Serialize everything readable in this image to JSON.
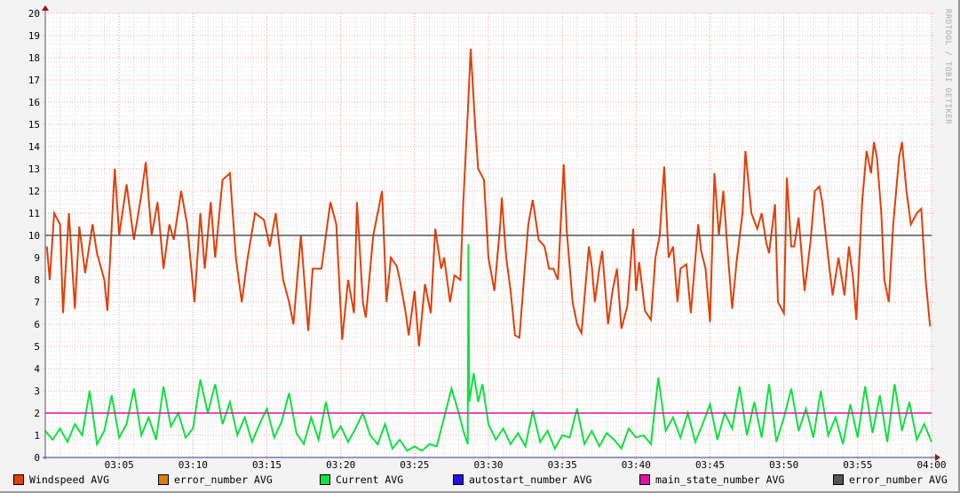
{
  "watermark": "RRDTOOL / TOBI OETIKER",
  "chart_data": {
    "type": "line",
    "title": "",
    "xlabel": "",
    "ylabel": "",
    "ylim": [
      0,
      20
    ],
    "xlim_minutes": [
      0,
      60
    ],
    "y_ticks": [
      "0",
      "1",
      "2",
      "3",
      "4",
      "5",
      "6",
      "7",
      "8",
      "9",
      "10",
      "11",
      "12",
      "13",
      "14",
      "15",
      "16",
      "17",
      "18",
      "19",
      "20"
    ],
    "x_ticks": [
      {
        "t": 5,
        "label": "03:05"
      },
      {
        "t": 10,
        "label": "03:10"
      },
      {
        "t": 15,
        "label": "03:15"
      },
      {
        "t": 20,
        "label": "03:20"
      },
      {
        "t": 25,
        "label": "03:25"
      },
      {
        "t": 30,
        "label": "03:30"
      },
      {
        "t": 35,
        "label": "03:35"
      },
      {
        "t": 40,
        "label": "03:40"
      },
      {
        "t": 45,
        "label": "03:45"
      },
      {
        "t": 50,
        "label": "03:50"
      },
      {
        "t": 55,
        "label": "03:55"
      },
      {
        "t": 60,
        "label": "04:00"
      }
    ],
    "grid": true,
    "legend_position": "bottom",
    "legend": [
      {
        "label": "Windspeed AVG",
        "color": "#e0400a"
      },
      {
        "label": "error_number AVG",
        "color": "#e07a0a"
      },
      {
        "label": "Current AVG",
        "color": "#10e040"
      },
      {
        "label": "autostart_number AVG",
        "color": "#2a10e0"
      },
      {
        "label": "main_state_number AVG",
        "color": "#e010a0"
      },
      {
        "label": "error_number AVG",
        "color": "#555555"
      }
    ],
    "series": [
      {
        "name": "Windspeed AVG",
        "color": "#e0400a",
        "points": [
          [
            0.1,
            9.5
          ],
          [
            0.3,
            8
          ],
          [
            0.6,
            11
          ],
          [
            1.0,
            10.5
          ],
          [
            1.2,
            6.5
          ],
          [
            1.6,
            11
          ],
          [
            2.0,
            6.7
          ],
          [
            2.3,
            10.4
          ],
          [
            2.7,
            8.3
          ],
          [
            3.2,
            10.5
          ],
          [
            3.5,
            9.2
          ],
          [
            4.0,
            8
          ],
          [
            4.2,
            6.6
          ],
          [
            4.7,
            13
          ],
          [
            5.0,
            10
          ],
          [
            5.5,
            12.3
          ],
          [
            6.0,
            9.8
          ],
          [
            6.5,
            11.8
          ],
          [
            6.8,
            13.3
          ],
          [
            7.2,
            10
          ],
          [
            7.6,
            11.5
          ],
          [
            8.0,
            8.5
          ],
          [
            8.4,
            10.5
          ],
          [
            8.7,
            9.8
          ],
          [
            9.2,
            12
          ],
          [
            9.6,
            10.5
          ],
          [
            10.1,
            7
          ],
          [
            10.5,
            11
          ],
          [
            10.8,
            8.5
          ],
          [
            11.2,
            11.5
          ],
          [
            11.5,
            9
          ],
          [
            12.0,
            12.5
          ],
          [
            12.5,
            12.8
          ],
          [
            12.9,
            9
          ],
          [
            13.3,
            7
          ],
          [
            13.7,
            9
          ],
          [
            14.2,
            11
          ],
          [
            14.8,
            10.7
          ],
          [
            15.2,
            9.5
          ],
          [
            15.6,
            11
          ],
          [
            16.1,
            8
          ],
          [
            16.5,
            7
          ],
          [
            16.8,
            6
          ],
          [
            17.3,
            10
          ],
          [
            17.8,
            5.7
          ],
          [
            18.1,
            8.5
          ],
          [
            18.7,
            8.5
          ],
          [
            19.3,
            11.5
          ],
          [
            19.7,
            10.5
          ],
          [
            20.1,
            5.3
          ],
          [
            20.5,
            8
          ],
          [
            20.9,
            6.5
          ],
          [
            21.1,
            11.5
          ],
          [
            21.5,
            7
          ],
          [
            21.7,
            6.3
          ],
          [
            22.2,
            10
          ],
          [
            22.5,
            11
          ],
          [
            22.8,
            12
          ],
          [
            23.1,
            7
          ],
          [
            23.4,
            9
          ],
          [
            23.8,
            8.6
          ],
          [
            24.0,
            8
          ],
          [
            24.4,
            6.5
          ],
          [
            24.6,
            5.5
          ],
          [
            25.0,
            7.5
          ],
          [
            25.3,
            5
          ],
          [
            25.7,
            7.8
          ],
          [
            26.1,
            6.5
          ],
          [
            26.4,
            10.3
          ],
          [
            26.8,
            8.5
          ],
          [
            27.0,
            9
          ],
          [
            27.4,
            7
          ],
          [
            27.7,
            8.2
          ],
          [
            28.1,
            8
          ],
          [
            28.3,
            11.5
          ],
          [
            28.6,
            15.5
          ],
          [
            28.8,
            18.4
          ],
          [
            29.1,
            15
          ],
          [
            29.3,
            13
          ],
          [
            29.7,
            12.5
          ],
          [
            30.0,
            9
          ],
          [
            30.4,
            7.5
          ],
          [
            30.8,
            10.5
          ],
          [
            30.9,
            11.7
          ],
          [
            31.2,
            9
          ],
          [
            31.5,
            7.5
          ],
          [
            31.8,
            5.5
          ],
          [
            32.1,
            5.4
          ],
          [
            32.4,
            8
          ],
          [
            32.7,
            10.5
          ],
          [
            33.0,
            11.6
          ],
          [
            33.4,
            9.8
          ],
          [
            33.8,
            9.5
          ],
          [
            34.1,
            8.5
          ],
          [
            34.4,
            8.5
          ],
          [
            34.7,
            8
          ],
          [
            35.1,
            13.2
          ],
          [
            35.3,
            10.2
          ],
          [
            35.7,
            7
          ],
          [
            36.0,
            6
          ],
          [
            36.3,
            5.6
          ],
          [
            36.8,
            9.5
          ],
          [
            37.0,
            8.6
          ],
          [
            37.2,
            7
          ],
          [
            37.5,
            8.5
          ],
          [
            37.7,
            9.3
          ],
          [
            38.1,
            6
          ],
          [
            38.4,
            7.5
          ],
          [
            38.7,
            8.5
          ],
          [
            39.0,
            5.8
          ],
          [
            39.4,
            6.8
          ],
          [
            39.8,
            10.3
          ],
          [
            40.0,
            7.5
          ],
          [
            40.2,
            8.8
          ],
          [
            40.6,
            6.6
          ],
          [
            41.0,
            6.2
          ],
          [
            41.3,
            9
          ],
          [
            41.6,
            10
          ],
          [
            41.9,
            13.1
          ],
          [
            42.2,
            9
          ],
          [
            42.5,
            9.5
          ],
          [
            42.8,
            7
          ],
          [
            43.0,
            8.5
          ],
          [
            43.4,
            8.7
          ],
          [
            43.7,
            6.5
          ],
          [
            44.2,
            10.5
          ],
          [
            44.4,
            9.3
          ],
          [
            44.7,
            8.5
          ],
          [
            45.0,
            6.1
          ],
          [
            45.3,
            12.8
          ],
          [
            45.6,
            10
          ],
          [
            45.9,
            12
          ],
          [
            46.2,
            9.2
          ],
          [
            46.5,
            6.7
          ],
          [
            46.8,
            8.8
          ],
          [
            47.2,
            11
          ],
          [
            47.4,
            13.8
          ],
          [
            47.8,
            11
          ],
          [
            48.2,
            10.3
          ],
          [
            48.5,
            11
          ],
          [
            48.8,
            9.7
          ],
          [
            49.0,
            9.2
          ],
          [
            49.4,
            11.4
          ],
          [
            49.6,
            7
          ],
          [
            50.0,
            6.5
          ],
          [
            50.2,
            12.6
          ],
          [
            50.5,
            9.5
          ],
          [
            50.7,
            9.5
          ],
          [
            51.0,
            10.8
          ],
          [
            51.4,
            7.5
          ],
          [
            51.8,
            9.7
          ],
          [
            52.1,
            12
          ],
          [
            52.4,
            12.2
          ],
          [
            52.6,
            11.5
          ],
          [
            53.0,
            9
          ],
          [
            53.3,
            7.3
          ],
          [
            53.7,
            9
          ],
          [
            54.1,
            7.3
          ],
          [
            54.4,
            9.5
          ],
          [
            54.7,
            8
          ],
          [
            54.9,
            6.2
          ],
          [
            55.3,
            11.5
          ],
          [
            55.6,
            13.8
          ],
          [
            55.9,
            12.8
          ],
          [
            56.1,
            14.2
          ],
          [
            56.3,
            13.5
          ],
          [
            56.6,
            11
          ],
          [
            56.8,
            8
          ],
          [
            57.1,
            7
          ],
          [
            57.4,
            10.5
          ],
          [
            57.8,
            13.5
          ],
          [
            58.0,
            14.2
          ],
          [
            58.3,
            12
          ],
          [
            58.6,
            10.5
          ],
          [
            59.0,
            11
          ],
          [
            59.3,
            11.2
          ],
          [
            59.6,
            8
          ],
          [
            59.9,
            5.9
          ]
        ]
      },
      {
        "name": "Current AVG",
        "color": "#10e040",
        "points": [
          [
            0,
            1.2
          ],
          [
            0.5,
            0.8
          ],
          [
            1,
            1.3
          ],
          [
            1.5,
            0.7
          ],
          [
            2,
            1.5
          ],
          [
            2.5,
            1.0
          ],
          [
            3,
            3.0
          ],
          [
            3.5,
            0.6
          ],
          [
            4,
            1.2
          ],
          [
            4.5,
            2.8
          ],
          [
            5,
            0.9
          ],
          [
            5.5,
            1.5
          ],
          [
            6,
            3.1
          ],
          [
            6.5,
            1.0
          ],
          [
            7,
            1.8
          ],
          [
            7.5,
            0.8
          ],
          [
            8,
            3.2
          ],
          [
            8.5,
            1.4
          ],
          [
            9,
            2.0
          ],
          [
            9.5,
            0.9
          ],
          [
            10,
            1.3
          ],
          [
            10.5,
            3.5
          ],
          [
            11,
            2.0
          ],
          [
            11.5,
            3.3
          ],
          [
            12,
            1.5
          ],
          [
            12.5,
            2.5
          ],
          [
            13,
            1.0
          ],
          [
            13.5,
            1.8
          ],
          [
            14,
            0.7
          ],
          [
            14.5,
            1.5
          ],
          [
            15,
            2.2
          ],
          [
            15.5,
            0.9
          ],
          [
            16,
            1.6
          ],
          [
            16.5,
            2.9
          ],
          [
            17,
            1.1
          ],
          [
            17.5,
            0.6
          ],
          [
            18,
            1.8
          ],
          [
            18.5,
            0.8
          ],
          [
            19,
            2.5
          ],
          [
            19.5,
            0.9
          ],
          [
            20,
            1.4
          ],
          [
            20.5,
            0.7
          ],
          [
            21,
            1.3
          ],
          [
            21.5,
            2.0
          ],
          [
            22,
            1.0
          ],
          [
            22.5,
            0.6
          ],
          [
            23,
            1.5
          ],
          [
            23.5,
            0.4
          ],
          [
            24,
            0.8
          ],
          [
            24.5,
            0.3
          ],
          [
            25,
            0.5
          ],
          [
            25.5,
            0.3
          ],
          [
            26,
            0.6
          ],
          [
            26.5,
            0.5
          ],
          [
            27,
            1.8
          ],
          [
            27.5,
            3.1
          ],
          [
            28,
            2.0
          ],
          [
            28.3,
            1.2
          ],
          [
            28.6,
            0.6
          ],
          [
            28.65,
            9.6
          ],
          [
            28.7,
            2.5
          ],
          [
            29,
            3.8
          ],
          [
            29.3,
            2.5
          ],
          [
            29.6,
            3.3
          ],
          [
            30,
            1.5
          ],
          [
            30.5,
            0.8
          ],
          [
            31,
            1.3
          ],
          [
            31.5,
            0.6
          ],
          [
            32,
            1.1
          ],
          [
            32.5,
            0.5
          ],
          [
            33,
            2.1
          ],
          [
            33.5,
            0.7
          ],
          [
            34,
            1.2
          ],
          [
            34.5,
            0.4
          ],
          [
            35,
            1.0
          ],
          [
            35.5,
            0.9
          ],
          [
            36,
            2.2
          ],
          [
            36.5,
            0.6
          ],
          [
            37,
            1.2
          ],
          [
            37.5,
            0.5
          ],
          [
            38,
            1.1
          ],
          [
            38.5,
            0.8
          ],
          [
            39,
            0.4
          ],
          [
            39.5,
            1.3
          ],
          [
            40,
            0.9
          ],
          [
            40.5,
            1.0
          ],
          [
            41,
            0.6
          ],
          [
            41.5,
            3.6
          ],
          [
            42,
            1.2
          ],
          [
            42.5,
            1.8
          ],
          [
            43,
            0.9
          ],
          [
            43.5,
            2.0
          ],
          [
            44,
            0.7
          ],
          [
            44.5,
            1.5
          ],
          [
            45,
            2.4
          ],
          [
            45.5,
            0.8
          ],
          [
            46,
            2.0
          ],
          [
            46.5,
            1.3
          ],
          [
            47,
            3.2
          ],
          [
            47.5,
            1.0
          ],
          [
            48,
            2.5
          ],
          [
            48.5,
            0.9
          ],
          [
            49,
            3.3
          ],
          [
            49.5,
            0.7
          ],
          [
            50,
            1.8
          ],
          [
            50.5,
            3.1
          ],
          [
            51,
            1.2
          ],
          [
            51.5,
            2.2
          ],
          [
            52,
            0.9
          ],
          [
            52.5,
            3.0
          ],
          [
            53,
            1.0
          ],
          [
            53.5,
            1.8
          ],
          [
            54,
            0.6
          ],
          [
            54.5,
            2.4
          ],
          [
            55,
            0.9
          ],
          [
            55.5,
            3.2
          ],
          [
            56,
            1.1
          ],
          [
            56.5,
            2.8
          ],
          [
            57,
            0.7
          ],
          [
            57.5,
            3.3
          ],
          [
            58,
            1.2
          ],
          [
            58.5,
            2.5
          ],
          [
            59,
            0.8
          ],
          [
            59.5,
            1.5
          ],
          [
            60,
            0.7
          ]
        ]
      },
      {
        "name": "main_state_number AVG",
        "color": "#e010a0",
        "constant": 2
      },
      {
        "name": "error_number AVG",
        "color": "#555555",
        "constant": 10
      }
    ]
  }
}
